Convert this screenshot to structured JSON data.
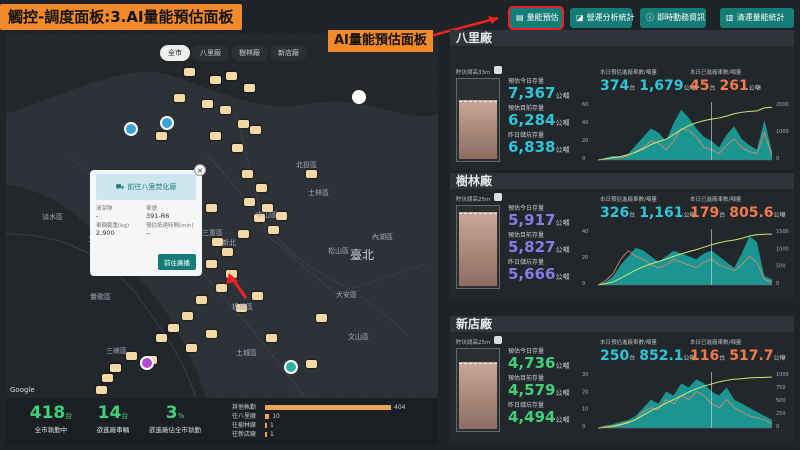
{
  "title": "觸控-調度面板:3.AI量能預估面板",
  "annotation": "AI量能預估面板",
  "top_buttons": [
    {
      "label": "量能預估",
      "icon": "table-icon"
    },
    {
      "label": "營運分析統計",
      "icon": "chart-icon"
    },
    {
      "label": "即時動務資訊",
      "icon": "info-icon"
    },
    {
      "label": "清運量能統計",
      "icon": "stats-icon"
    }
  ],
  "map": {
    "filters": [
      "全市",
      "八里廠",
      "樹林廠",
      "新店廠"
    ],
    "active_filter": "全市",
    "labels": [
      {
        "name": "北投區"
      },
      {
        "name": "士林區"
      },
      {
        "name": "中山區"
      },
      {
        "name": "松山區"
      },
      {
        "name": "內湖區"
      },
      {
        "name": "臺北"
      },
      {
        "name": "大安區"
      },
      {
        "name": "文山區"
      },
      {
        "name": "新北"
      },
      {
        "name": "板橋區"
      },
      {
        "name": "三重區"
      },
      {
        "name": "蘆洲區"
      },
      {
        "name": "淡水區"
      },
      {
        "name": "五股區"
      },
      {
        "name": "土城區"
      },
      {
        "name": "鶯歌區"
      },
      {
        "name": "三峽區"
      }
    ],
    "attribution": "Google",
    "popup": {
      "header": "前往八里焚化廠",
      "fields": [
        {
          "label": "清潔隊",
          "value": "-"
        },
        {
          "label": "車號",
          "value": "391-R6"
        },
        {
          "label": "車輛載重(kg)",
          "value": "2,900"
        },
        {
          "label": "預估抵達時間(min)",
          "value": "--"
        }
      ],
      "button": "前往廣播",
      "close": "×"
    }
  },
  "bottom_stats": [
    {
      "value": "418",
      "unit": "台",
      "label": "全市執勤中"
    },
    {
      "value": "14",
      "unit": "台",
      "label": "欲進廠車輛"
    },
    {
      "value": "3",
      "unit": "%",
      "label": "欲進廠佔全市執勤"
    }
  ],
  "bottom_legend": [
    {
      "label": "其他執勤",
      "value": "404",
      "fraction": 0.9
    },
    {
      "label": "往八里廠",
      "value": "10",
      "fraction": 0.03
    },
    {
      "label": "往樹林廠",
      "value": "1",
      "fraction": 0.01
    },
    {
      "label": "往新店廠",
      "value": "1",
      "fraction": 0.01
    }
  ],
  "chart_legend": [
    "預估進廠量",
    "預估抵達時間",
    "預估累積量",
    "實際進廠量"
  ],
  "panels": [
    {
      "name": "八里廠",
      "tank_label": "貯坑總高33m",
      "tank_fill": 0.72,
      "stats": [
        {
          "label": "預估今日存量",
          "value": "7,367",
          "unit": "公噸",
          "color": "#2ec5d8"
        },
        {
          "label": "預估目前存量",
          "value": "6,284",
          "unit": "公噸",
          "color": "#2ec5d8"
        },
        {
          "label": "昨日儲坑存量",
          "value": "6,838",
          "unit": "公噸",
          "color": "#2ec5d8"
        }
      ],
      "kpi_left_label": "本日預估進廠車數/噸量",
      "kpi_left": [
        {
          "value": "374",
          "unit": "台"
        },
        {
          "value": "1,679",
          "unit": "公噸"
        }
      ],
      "kpi_left_color": "#2ec5d8",
      "kpi_right_label": "本日已進廠車數/噸量",
      "kpi_right": [
        {
          "value": "45",
          "unit": "台"
        },
        {
          "value": "261",
          "unit": "公噸"
        }
      ],
      "kpi_right_color": "#f27a4c",
      "chart_data": {
        "type": "area",
        "y_left_ticks": [
          "60",
          "40",
          "20",
          "0"
        ],
        "y_right_ticks": [
          "2000",
          "1000",
          "0"
        ],
        "series": [
          {
            "values": [
              0,
              2,
              4,
              3,
              6,
              14,
              22,
              30,
              26,
              18,
              35,
              48,
              40,
              30,
              22,
              18,
              12,
              24,
              32,
              20,
              14,
              10,
              38,
              8
            ]
          },
          {
            "values": [
              0,
              1,
              2,
              2,
              4,
              8,
              12,
              18,
              16,
              10,
              18,
              30,
              28,
              22,
              12,
              10,
              6,
              14,
              20,
              12,
              8,
              6,
              26,
              4
            ]
          },
          {
            "values": [
              0,
              40,
              80,
              120,
              180,
              260,
              380,
              520,
              620,
              700,
              860,
              1020,
              1160,
              1260,
              1330,
              1380,
              1420,
              1480,
              1560,
              1610,
              1640,
              1660,
              1760,
              1780
            ]
          }
        ]
      }
    },
    {
      "name": "樹林廠",
      "tank_label": "貯坑總高25m",
      "tank_fill": 0.9,
      "stats": [
        {
          "label": "預估今日存量",
          "value": "5,917",
          "unit": "公噸",
          "color": "#8a7ae6"
        },
        {
          "label": "預估目前存量",
          "value": "5,827",
          "unit": "公噸",
          "color": "#8a7ae6"
        },
        {
          "label": "昨日儲坑存量",
          "value": "5,666",
          "unit": "公噸",
          "color": "#8a7ae6"
        }
      ],
      "kpi_left_label": "本日預估進廠車數/噸量",
      "kpi_left": [
        {
          "value": "326",
          "unit": "台"
        },
        {
          "value": "1,161",
          "unit": "公噸"
        }
      ],
      "kpi_left_color": "#2ec5d8",
      "kpi_right_label": "本日已進廠車數/噸量",
      "kpi_right": [
        {
          "value": "179",
          "unit": "台"
        },
        {
          "value": "805.6",
          "unit": "公噸"
        }
      ],
      "kpi_right_color": "#f27a4c",
      "chart_data": {
        "type": "area",
        "y_left_ticks": [
          "40",
          "20",
          "0"
        ],
        "y_right_ticks": [
          "1500",
          "1000",
          "500",
          "0"
        ],
        "series": [
          {
            "values": [
              0,
              2,
              6,
              14,
              20,
              26,
              24,
              20,
              16,
              20,
              24,
              22,
              20,
              18,
              22,
              24,
              20,
              16,
              12,
              22,
              34,
              30,
              6,
              4
            ]
          },
          {
            "values": [
              0,
              3,
              8,
              18,
              24,
              20,
              18,
              14,
              12,
              14,
              18,
              16,
              14,
              12,
              16,
              18,
              14,
              12,
              10,
              14,
              20,
              16,
              4,
              2
            ]
          },
          {
            "values": [
              0,
              40,
              90,
              200,
              320,
              440,
              540,
              620,
              690,
              760,
              840,
              910,
              980,
              1040,
              1110,
              1180,
              1240,
              1290,
              1320,
              1370,
              1440,
              1480,
              1490,
              1495
            ]
          }
        ]
      }
    },
    {
      "name": "新店廠",
      "tank_label": "貯坑總高25m",
      "tank_fill": 0.82,
      "stats": [
        {
          "label": "預估今日存量",
          "value": "4,736",
          "unit": "公噸",
          "color": "#3fd07a"
        },
        {
          "label": "預估目前存量",
          "value": "4,579",
          "unit": "公噸",
          "color": "#3fd07a"
        },
        {
          "label": "昨日儲坑存量",
          "value": "4,494",
          "unit": "公噸",
          "color": "#3fd07a"
        }
      ],
      "kpi_left_label": "本日預估進廠車數/噸量",
      "kpi_left": [
        {
          "value": "250",
          "unit": "台"
        },
        {
          "value": "852.1",
          "unit": "公噸"
        }
      ],
      "kpi_left_color": "#2ec5d8",
      "kpi_right_label": "本日已進廠車數/噸量",
      "kpi_right": [
        {
          "value": "116",
          "unit": "台"
        },
        {
          "value": "517.7",
          "unit": "公噸"
        }
      ],
      "kpi_right_color": "#f27a4c",
      "chart_data": {
        "type": "area",
        "y_left_ticks": [
          "30",
          "20",
          "10",
          "0"
        ],
        "y_right_ticks": [
          "1000",
          "750",
          "500",
          "250",
          "0"
        ],
        "series": [
          {
            "values": [
              0,
              1,
              2,
              3,
              4,
              6,
              10,
              14,
              12,
              18,
              16,
              22,
              20,
              24,
              22,
              18,
              16,
              20,
              14,
              12,
              10,
              8,
              6,
              4
            ]
          },
          {
            "values": [
              0,
              1,
              1,
              2,
              3,
              4,
              8,
              10,
              9,
              14,
              12,
              16,
              14,
              18,
              16,
              12,
              10,
              14,
              10,
              8,
              6,
              5,
              4,
              2
            ]
          },
          {
            "values": [
              0,
              10,
              30,
              60,
              100,
              160,
              240,
              320,
              390,
              460,
              530,
              600,
              670,
              730,
              780,
              820,
              860,
              890,
              910,
              920,
              935,
              940,
              945,
              950
            ]
          }
        ]
      }
    }
  ]
}
